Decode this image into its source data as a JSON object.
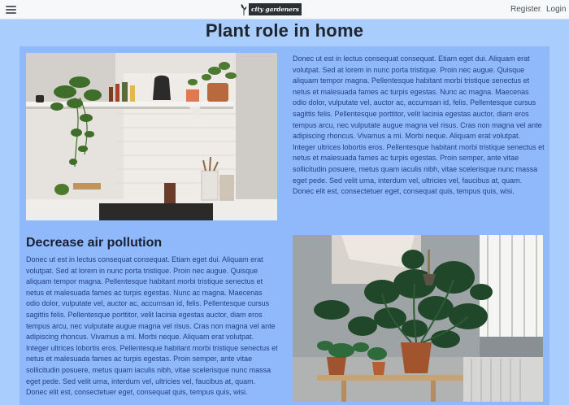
{
  "header": {
    "menu_icon": "hamburger-icon",
    "logo_text": "city gardeners",
    "logo_icon": "sprout-icon",
    "nav": {
      "register": "Register",
      "separator": ".",
      "login": "Login"
    }
  },
  "page": {
    "title": "Plant role in home"
  },
  "sections": [
    {
      "image": "kitchen-plants-photo",
      "heading": "",
      "text": "Donec ut est in lectus consequat consequat. Etiam eget dui. Aliquam erat volutpat. Sed at lorem in nunc porta tristique. Proin nec augue. Quisque aliquam tempor magna. Pellentesque habitant morbi tristique senectus et netus et malesuada fames ac turpis egestas. Nunc ac magna. Maecenas odio dolor, vulputate vel, auctor ac, accumsan id, felis. Pellentesque cursus sagittis felis. Pellentesque porttitor, velit lacinia egestas auctor, diam eros tempus arcu, nec vulputate augue magna vel risus. Cras non magna vel ante adipiscing rhoncus. Vivamus a mi. Morbi neque. Aliquam erat volutpat. Integer ultrices lobortis eros. Pellentesque habitant morbi tristique senectus et netus et malesuada fames ac turpis egestas. Proin semper, ante vitae sollicitudin posuere, metus quam iaculis nibh, vitae scelerisque nunc massa eget pede. Sed velit urna, interdum vel, ultricies vel, faucibus at, quam. Donec elit est, consectetuer eget, consequat quis, tempus quis, wisi."
    },
    {
      "image": "monstera-plants-photo",
      "heading": "Decrease air pollution",
      "text": "Donec ut est in lectus consequat consequat. Etiam eget dui. Aliquam erat volutpat. Sed at lorem in nunc porta tristique. Proin nec augue. Quisque aliquam tempor magna. Pellentesque habitant morbi tristique senectus et netus et malesuada fames ac turpis egestas. Nunc ac magna. Maecenas odio dolor, vulputate vel, auctor ac, accumsan id, felis. Pellentesque cursus sagittis felis. Pellentesque porttitor, velit lacinia egestas auctor, diam eros tempus arcu, nec vulputate augue magna vel risus. Cras non magna vel ante adipiscing rhoncus. Vivamus a mi. Morbi neque. Aliquam erat volutpat. Integer ultrices lobortis eros. Pellentesque habitant morbi tristique senectus et netus et malesuada fames ac turpis egestas. Proin semper, ante vitae sollicitudin posuere, metus quam iaculis nibh, vitae scelerisque nunc massa eget pede. Sed velit urna, interdum vel, ultricies vel, faucibus at, quam. Donec elit est, consectetuer eget, consequat quis, tempus quis, wisi."
    }
  ],
  "colors": {
    "background": "#a9cdfd",
    "panel": "#8fb9fb",
    "text": "#24408a",
    "topbar": "#f7f8fa"
  }
}
